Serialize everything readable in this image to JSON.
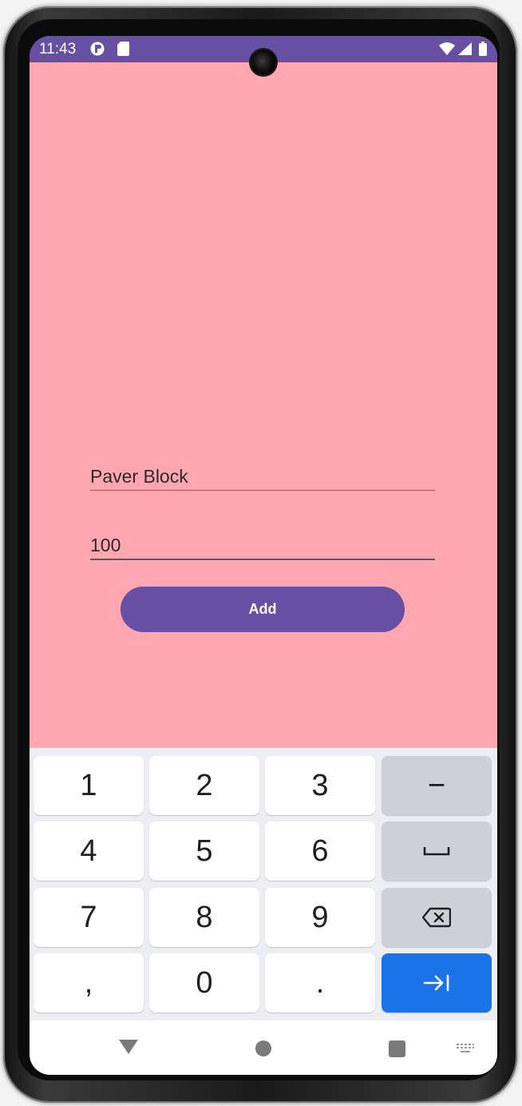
{
  "status_bar": {
    "time": "11:43",
    "icons": [
      "media-icon",
      "sd-card-icon",
      "wifi-icon",
      "signal-icon",
      "battery-icon"
    ]
  },
  "form": {
    "item_name_value": "Paver Block",
    "quantity_value": "100",
    "add_button_label": "Add"
  },
  "keyboard": {
    "keys": [
      [
        "1",
        "2",
        "3",
        "−"
      ],
      [
        "4",
        "5",
        "6",
        "space-icon"
      ],
      [
        "7",
        "8",
        "9",
        "backspace-icon"
      ],
      [
        ",",
        "0",
        ".",
        "next-icon"
      ]
    ]
  },
  "navigation": [
    "back-triangle-icon",
    "home-circle-icon",
    "recents-square-icon",
    "keyboard-switch-icon"
  ],
  "colors": {
    "app_background": "#ffa6b1",
    "primary": "#6750a4",
    "keyboard_background": "#eceef3",
    "function_key": "#cdd0d7",
    "enter_key": "#1a73e8"
  }
}
